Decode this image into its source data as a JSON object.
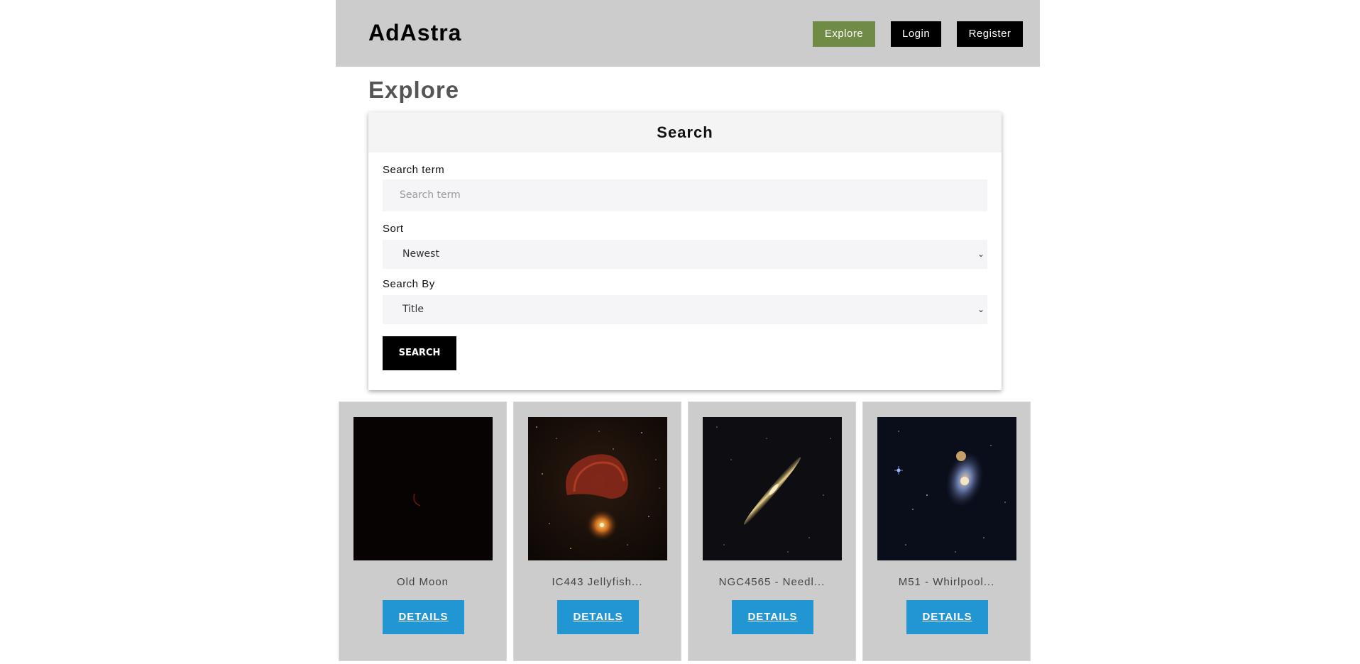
{
  "header": {
    "brand": "AdAstra",
    "nav": {
      "explore": "Explore",
      "login": "Login",
      "register": "Register"
    },
    "accent": "#6f8b46"
  },
  "page": {
    "title": "Explore"
  },
  "search": {
    "heading": "Search",
    "term_label": "Search term",
    "term_placeholder": "Search term",
    "sort_label": "Sort",
    "sort_value": "Newest",
    "by_label": "Search By",
    "by_value": "Title",
    "button": "SEARCH"
  },
  "results": [
    {
      "title": "Old Moon",
      "button": "DETAILS",
      "image": "dark-moon-crescent"
    },
    {
      "title": "IC443 Jellyfish...",
      "button": "DETAILS",
      "image": "jellyfish-nebula"
    },
    {
      "title": "NGC4565 - Needl...",
      "button": "DETAILS",
      "image": "needle-galaxy"
    },
    {
      "title": "M51 - Whirlpool...",
      "button": "DETAILS",
      "image": "whirlpool-galaxy"
    }
  ],
  "colors": {
    "details_button": "#2196d3",
    "header_bg": "#cccccc"
  }
}
